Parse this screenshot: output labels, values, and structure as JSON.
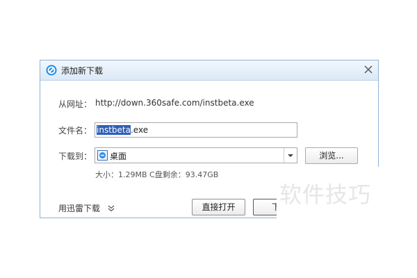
{
  "dialog": {
    "title": "添加新下载",
    "url_label": "从网址：",
    "url_value": "http://down.360safe.com/instbeta.exe",
    "filename_label": "文件名：",
    "filename_selected": "instbeta",
    "filename_ext": ".exe",
    "saveto_label": "下载到：",
    "saveto_value": "桌面",
    "browse_label": "浏览...",
    "size_info": "大小：1.29MB   C盘剩余：93.47GB",
    "thunder_label": "用迅雷下载",
    "direct_open_label": "直接打开",
    "download_label": "下"
  },
  "watermark": "软件技巧",
  "icons": {
    "title": "360-logo-icon",
    "close": "close-icon",
    "desktop": "desktop-icon",
    "combo_arrow": "chevron-down-icon",
    "thunder_chevron": "double-chevron-down-icon"
  },
  "colors": {
    "title_gradient_top": "#f1f7fd",
    "title_gradient_bottom": "#dbe9f7",
    "selection": "#2d5fb8",
    "border": "#8fb2d6"
  }
}
